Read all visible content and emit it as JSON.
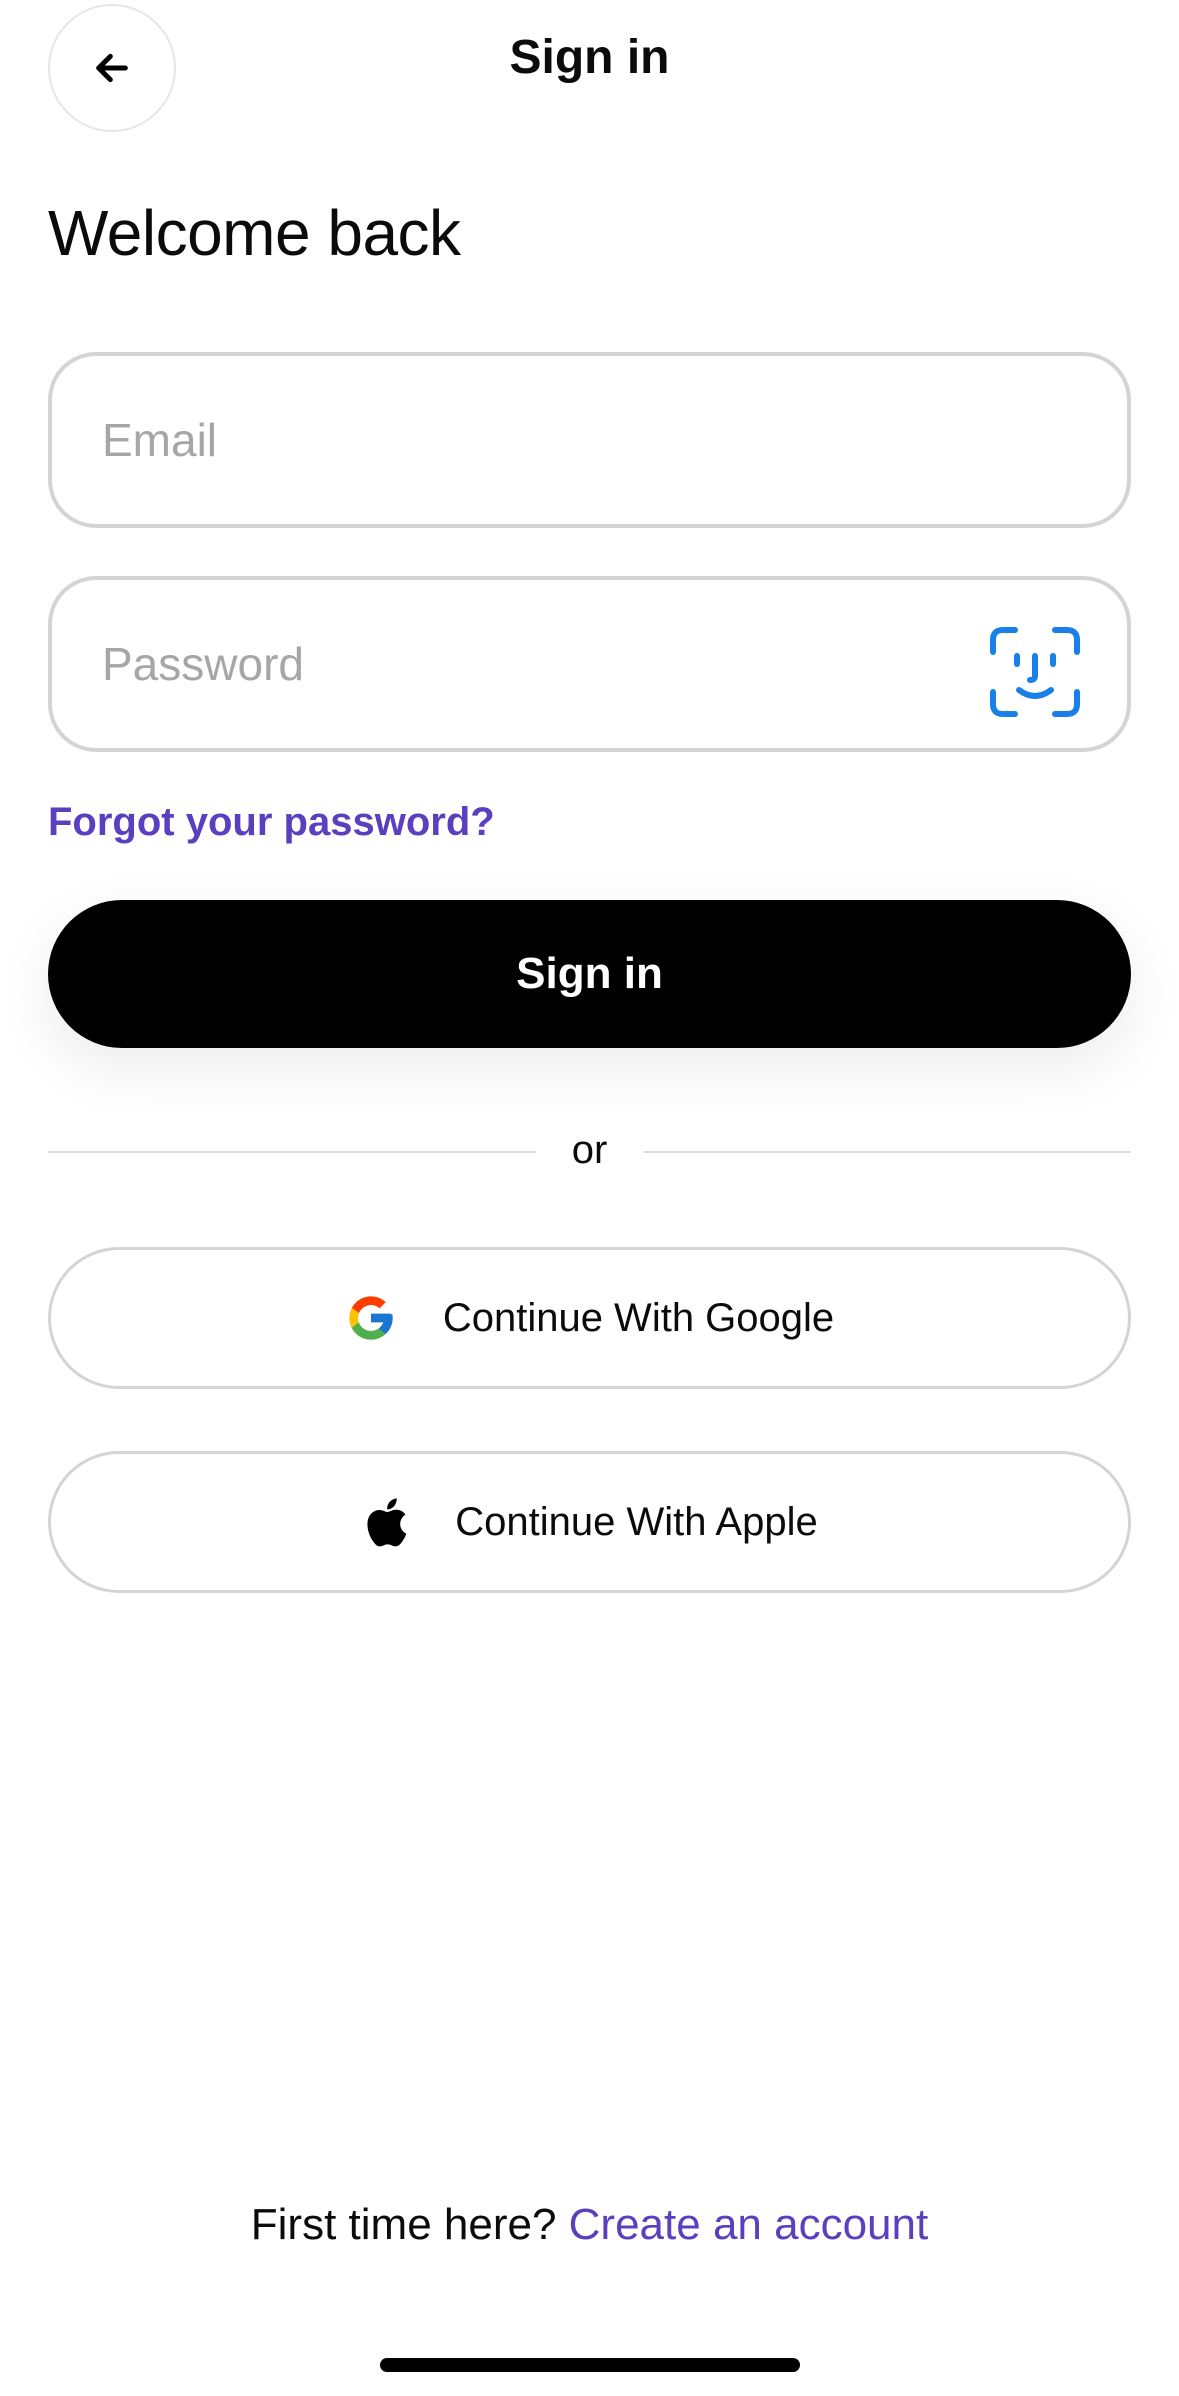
{
  "header": {
    "title": "Sign in",
    "back_icon": "arrow-left-icon"
  },
  "welcome_title": "Welcome back",
  "email": {
    "placeholder": "Email",
    "value": ""
  },
  "password": {
    "placeholder": "Password",
    "value": "",
    "icon": "face-id-icon"
  },
  "forgot_link": "Forgot your password?",
  "sign_in_button": "Sign in",
  "divider_text": "or",
  "social": {
    "google_label": "Continue With Google",
    "google_icon": "google-logo-icon",
    "apple_label": "Continue With Apple",
    "apple_icon": "apple-logo-icon"
  },
  "footer": {
    "prompt": "First time here?",
    "link": "Create an account"
  },
  "colors": {
    "accent": "#5b3fbf",
    "primary_button": "#000000",
    "faceid": "#1a7fe8",
    "field_border": "#d4d4d4"
  }
}
